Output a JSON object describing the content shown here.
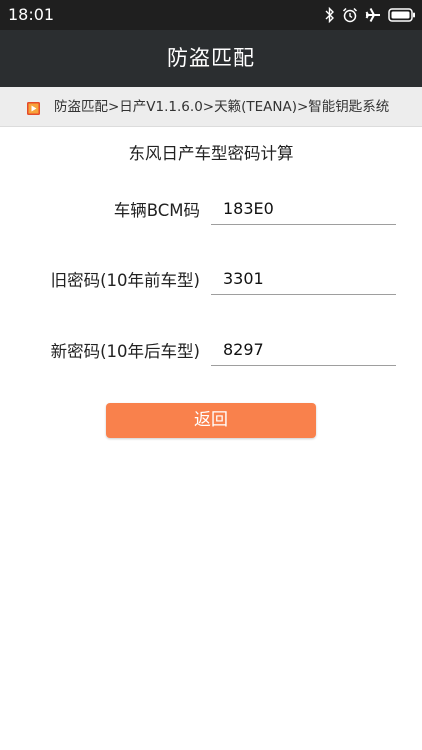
{
  "status_bar": {
    "time": "18:01",
    "icons": [
      "bluetooth-icon",
      "alarm-icon",
      "airplane-icon",
      "battery-icon"
    ]
  },
  "app_bar": {
    "title": "防盗匹配"
  },
  "breadcrumb": {
    "icon": "app-square-icon",
    "text": "防盗匹配>日产V1.1.6.0>天籁(TEANA)>智能钥匙系统"
  },
  "heading": "东风日产车型密码计算",
  "form": {
    "bcm": {
      "label": "车辆BCM码",
      "value": "183E0"
    },
    "old_password": {
      "label": "旧密码(10年前车型)",
      "value": "3301"
    },
    "new_password": {
      "label": "新密码(10年后车型)",
      "value": "8297"
    }
  },
  "back_button": {
    "label": "返回"
  },
  "colors": {
    "status_bar": "#1f1f1f",
    "app_bar": "#2b2e30",
    "breadcrumb_bar": "#ededed",
    "accent": "#f9814c"
  }
}
